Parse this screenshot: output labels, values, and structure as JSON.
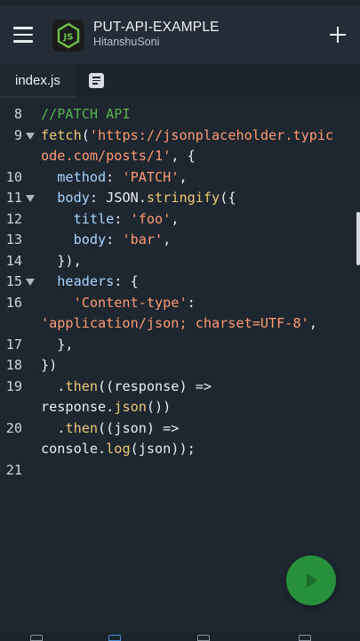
{
  "app": {
    "title": "PUT-API-EXAMPLE",
    "author": "HitanshuSoni",
    "logo_text": "JS"
  },
  "tabs": {
    "active_file": "index.js"
  },
  "editor": {
    "lines": [
      {
        "number": "8",
        "fold": false,
        "segments": [
          {
            "t": "//PATCH API",
            "c": "comment"
          }
        ]
      },
      {
        "number": "9",
        "fold": true,
        "segments": [
          {
            "t": "fetch",
            "c": "fn"
          },
          {
            "t": "(",
            "c": "plain"
          },
          {
            "t": "'https://jsonplaceholder.typic",
            "c": "str"
          }
        ]
      },
      {
        "number": "",
        "fold": false,
        "segments": [
          {
            "t": "ode.com/posts/1'",
            "c": "str"
          },
          {
            "t": ", {",
            "c": "plain"
          }
        ]
      },
      {
        "number": "10",
        "fold": false,
        "segments": [
          {
            "t": "  method",
            "c": "key"
          },
          {
            "t": ": ",
            "c": "plain"
          },
          {
            "t": "'PATCH'",
            "c": "str"
          },
          {
            "t": ",",
            "c": "plain"
          }
        ]
      },
      {
        "number": "11",
        "fold": true,
        "segments": [
          {
            "t": "  body",
            "c": "key"
          },
          {
            "t": ": JSON.",
            "c": "plain"
          },
          {
            "t": "stringify",
            "c": "fn"
          },
          {
            "t": "({",
            "c": "plain"
          }
        ]
      },
      {
        "number": "12",
        "fold": false,
        "segments": [
          {
            "t": "    title",
            "c": "key"
          },
          {
            "t": ": ",
            "c": "plain"
          },
          {
            "t": "'foo'",
            "c": "str"
          },
          {
            "t": ",",
            "c": "plain"
          }
        ]
      },
      {
        "number": "13",
        "fold": false,
        "segments": [
          {
            "t": "    body",
            "c": "key"
          },
          {
            "t": ": ",
            "c": "plain"
          },
          {
            "t": "'bar'",
            "c": "str"
          },
          {
            "t": ",",
            "c": "plain"
          }
        ]
      },
      {
        "number": "14",
        "fold": false,
        "segments": [
          {
            "t": "  }),",
            "c": "plain"
          }
        ]
      },
      {
        "number": "15",
        "fold": true,
        "segments": [
          {
            "t": "  headers",
            "c": "key"
          },
          {
            "t": ": {",
            "c": "plain"
          }
        ]
      },
      {
        "number": "16",
        "fold": false,
        "segments": [
          {
            "t": "    'Content-type'",
            "c": "str"
          },
          {
            "t": ":",
            "c": "plain"
          }
        ]
      },
      {
        "number": "",
        "fold": false,
        "segments": [
          {
            "t": "'application/json; charset=UTF-8'",
            "c": "str"
          },
          {
            "t": ",",
            "c": "plain"
          }
        ]
      },
      {
        "number": "17",
        "fold": false,
        "segments": [
          {
            "t": "  },",
            "c": "plain"
          }
        ]
      },
      {
        "number": "18",
        "fold": false,
        "segments": [
          {
            "t": "})",
            "c": "plain"
          }
        ]
      },
      {
        "number": "19",
        "fold": false,
        "segments": [
          {
            "t": "  .",
            "c": "plain"
          },
          {
            "t": "then",
            "c": "fn"
          },
          {
            "t": "((response) =>",
            "c": "plain"
          }
        ]
      },
      {
        "number": "",
        "fold": false,
        "segments": [
          {
            "t": "response.",
            "c": "plain"
          },
          {
            "t": "json",
            "c": "fn"
          },
          {
            "t": "())",
            "c": "plain"
          }
        ]
      },
      {
        "number": "20",
        "fold": false,
        "segments": [
          {
            "t": "  .",
            "c": "plain"
          },
          {
            "t": "then",
            "c": "fn"
          },
          {
            "t": "((json) =>",
            "c": "plain"
          }
        ]
      },
      {
        "number": "",
        "fold": false,
        "segments": [
          {
            "t": "console.",
            "c": "plain"
          },
          {
            "t": "log",
            "c": "fn"
          },
          {
            "t": "(json));",
            "c": "plain"
          }
        ]
      },
      {
        "number": "21",
        "fold": false,
        "segments": []
      }
    ]
  },
  "icons": {
    "menu": "hamburger-menu-icon",
    "add": "plus-icon",
    "doc": "document-icon",
    "run": "play-icon"
  },
  "colors": {
    "background": "#1e2630",
    "appbar": "#232c37",
    "run_button": "#27903d",
    "comment": "#55b24f",
    "string": "#ff9b72",
    "function": "#ebc875",
    "property": "#a8d6ff"
  }
}
